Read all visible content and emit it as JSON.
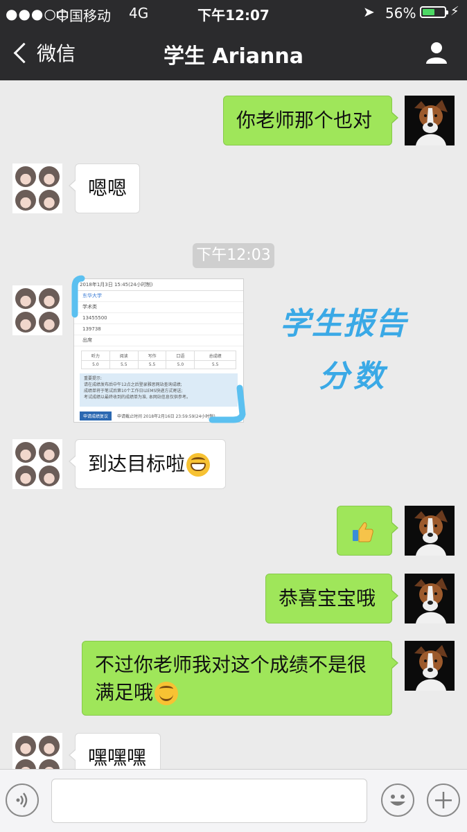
{
  "status_bar": {
    "signal": "●●●○○",
    "carrier": "中国移动",
    "network": "4G",
    "time": "下午12:07",
    "battery_percent": "56%",
    "battery_level": 0.56
  },
  "nav": {
    "back_label": "微信",
    "title": "学生 Arianna"
  },
  "messages": [
    {
      "side": "right",
      "text": "你老师那个也对"
    },
    {
      "side": "left",
      "text": "嗯嗯"
    },
    {
      "type": "timestamp",
      "text": "下午12:03"
    },
    {
      "side": "left",
      "type": "image",
      "image": {
        "header": "2018年1月3日 15:45(24小时制)",
        "rows": [
          "东华大学",
          "学术类",
          "13455500",
          "139738",
          "出席"
        ],
        "score_headers": [
          "听力",
          "阅读",
          "写作",
          "口语",
          "总成绩"
        ],
        "scores": [
          "5.0",
          "5.5",
          "5.5",
          "5.0",
          "5.5"
        ],
        "notice_title": "重要提示:",
        "notice_lines": [
          "请在成绩发布后中午12点之后登录雅思网站查询成绩;",
          "成绩单将于笔试后第10个工作日以EMS快递方式寄送;",
          "考试成绩以最终收到的成绩单为准, 本网站信息仅供参考。"
        ],
        "footer_button": "申请成绩复议",
        "footer_text": "申请截止时间 2018年2月16日 23:59:59(24小时制)",
        "annotation_line1": "学生报告",
        "annotation_line2": "分数"
      }
    },
    {
      "side": "left",
      "text": "到达目标啦",
      "emoji": "grinning-face"
    },
    {
      "side": "right",
      "type": "emoji",
      "emoji": "thumbs-up"
    },
    {
      "side": "right",
      "text": "恭喜宝宝哦"
    },
    {
      "side": "right",
      "text_line1": "不过你老师我对这个成绩不是很",
      "text_line2": "满足哦",
      "emoji": "smirking-face"
    },
    {
      "side": "left",
      "text": "嘿嘿嘿"
    }
  ],
  "icons": {
    "back": "chevron-left-icon",
    "contact": "person-icon",
    "location": "location-arrow-icon",
    "charging": "bolt-icon",
    "voice": "voice-icon",
    "emoji": "smiley-icon",
    "more": "plus-icon"
  },
  "colors": {
    "bar_bg": "#2b2b2d",
    "chat_bg": "#ebebeb",
    "outgoing_bubble": "#9fe65a",
    "incoming_bubble": "#ffffff",
    "annotation": "#3aa9e6"
  }
}
